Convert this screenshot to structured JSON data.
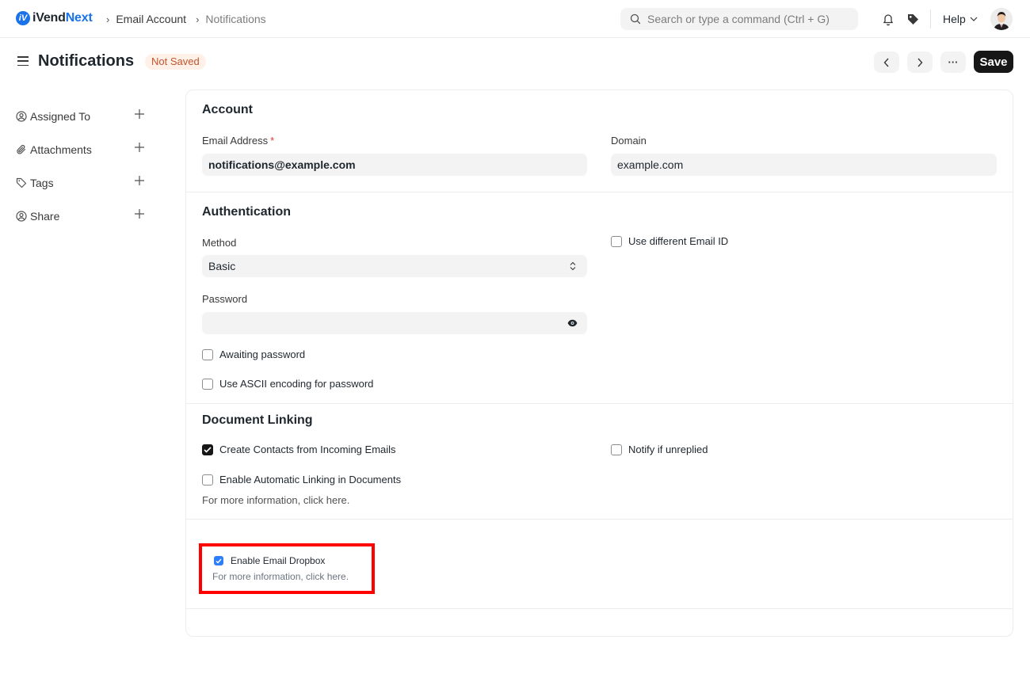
{
  "navbar": {
    "logo_mark": "iV",
    "logo_text_a": "iVend",
    "logo_text_b": "Next",
    "breadcrumbs": [
      "Email Account",
      "Notifications"
    ],
    "search_placeholder": "Search or type a command (Ctrl + G)",
    "help_label": "Help"
  },
  "page": {
    "title": "Notifications",
    "status_badge": "Not Saved",
    "save_label": "Save",
    "more_label": "···"
  },
  "sidebar": {
    "items": [
      {
        "label": "Assigned To",
        "icon": "assign-icon"
      },
      {
        "label": "Attachments",
        "icon": "paperclip-icon"
      },
      {
        "label": "Tags",
        "icon": "tag-icon"
      },
      {
        "label": "Share",
        "icon": "share-icon"
      }
    ]
  },
  "sections": {
    "account": {
      "title": "Account",
      "email_label": "Email Address",
      "email_required": "*",
      "email_value": "notifications@example.com",
      "domain_label": "Domain",
      "domain_value": "example.com"
    },
    "authentication": {
      "title": "Authentication",
      "method_label": "Method",
      "method_value": "Basic",
      "password_label": "Password",
      "password_value": "",
      "awaiting_password": "Awaiting password",
      "ascii_encoding": "Use ASCII encoding for password",
      "different_email": "Use different Email ID"
    },
    "document_linking": {
      "title": "Document Linking",
      "create_contacts": "Create Contacts from Incoming Emails",
      "create_contacts_checked": true,
      "auto_linking": "Enable Automatic Linking in Documents",
      "auto_linking_help": "For more information, click here.",
      "notify_unreplied": "Notify if unreplied"
    },
    "dropbox": {
      "enable_label": "Enable Email Dropbox",
      "enable_checked": true,
      "help": "For more information, click here."
    }
  },
  "colors": {
    "accent": "#1a73e8",
    "highlight": "#ff0000",
    "badge_bg": "#fff1e7",
    "badge_text": "#c4532e"
  }
}
